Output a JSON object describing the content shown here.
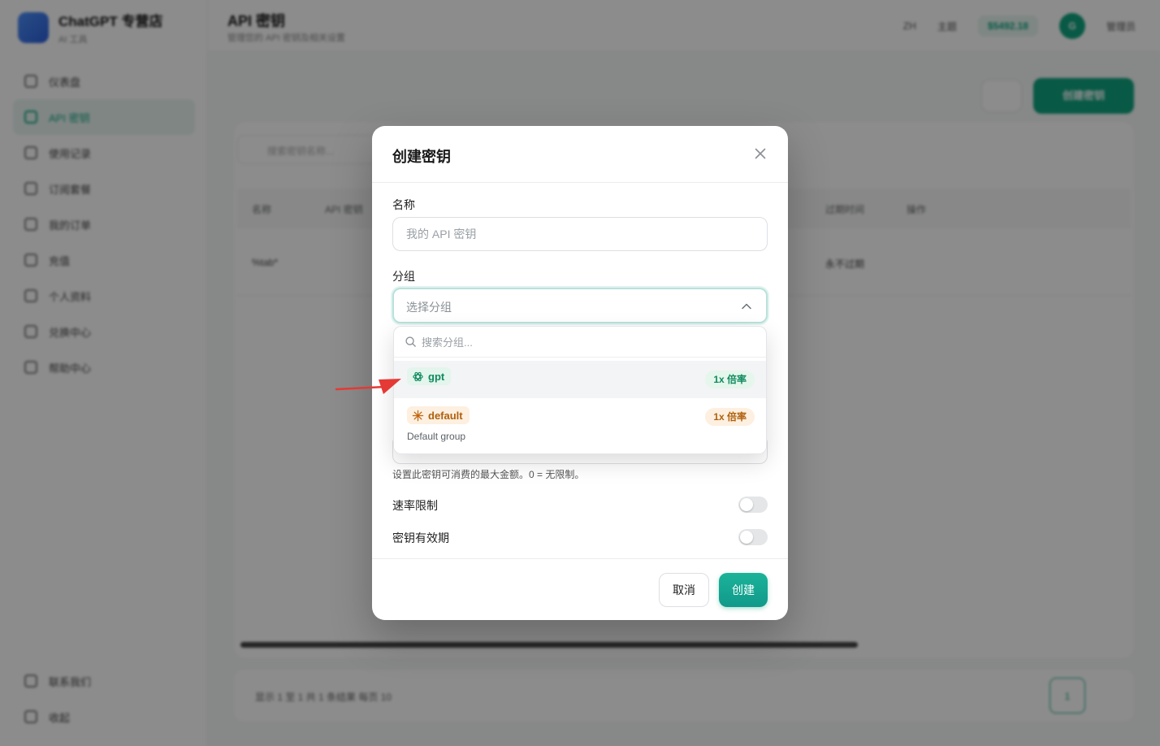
{
  "app": {
    "brand_name": "ChatGPT 专营店",
    "brand_sub": "AI 工具",
    "page_title": "API 密钥",
    "page_desc": "管理您的 API 密钥及相关设置",
    "nav": [
      "仪表盘",
      "API 密钥",
      "使用记录",
      "订阅套餐",
      "我的订单",
      "充值",
      "个人资料",
      "兑换中心",
      "帮助中心"
    ],
    "nav_bottom": [
      "联系我们",
      "收起"
    ],
    "top": {
      "lang": "ZH",
      "theme": "主题",
      "balance": "$5492.18",
      "user": "管理员",
      "avatar": "G"
    },
    "search_placeholder": "搜索密钥名称...",
    "create_button": "创建密钥",
    "table_headers": [
      "名称",
      "API 密钥",
      "过期时间",
      "操作"
    ],
    "row": {
      "name": "%tab*",
      "expires": "永不过期"
    },
    "pager_text": "显示 1 至 1 共 1 条结果  每页  10"
  },
  "modal": {
    "title": "创建密钥",
    "name_label": "名称",
    "name_placeholder": "我的 API 密钥",
    "group_label": "分组",
    "group_placeholder": "选择分组",
    "search_placeholder": "搜索分组...",
    "options": [
      {
        "name": "gpt",
        "ratio": "1x 倍率",
        "description": ""
      },
      {
        "name": "default",
        "ratio": "1x 倍率",
        "description": "Default group"
      }
    ],
    "quota_hint": "设置此密钥可消费的最大金额。0 = 无限制。",
    "rate_limit_label": "速率限制",
    "expiry_label": "密钥有效期",
    "rate_limit_enabled": false,
    "expiry_enabled": false,
    "cancel_label": "取消",
    "create_label": "创建"
  },
  "colors": {
    "accent": "#10a37f",
    "gpt_tag": "#0f8a5f",
    "default_tag": "#b0600d",
    "annotation_arrow": "#e53935"
  }
}
